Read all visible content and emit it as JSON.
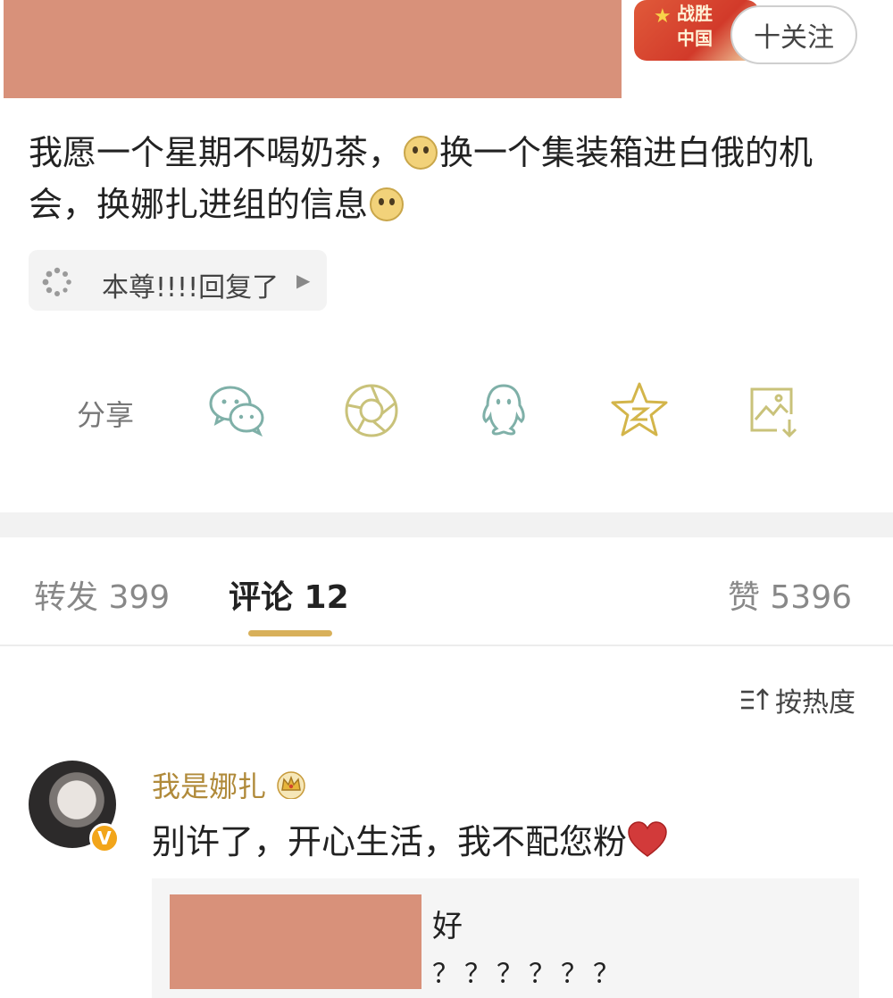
{
  "header": {
    "badge_text_line1": "战胜",
    "badge_text_line2": "中国",
    "follow_label": "十关注"
  },
  "post": {
    "text_part1": "我愿一个星期不喝奶茶，",
    "text_part2": "换一个集装箱进白俄的机会，换娜扎进组的信息",
    "reply_label": "本尊!!!!回复了"
  },
  "share": {
    "label": "分享",
    "icons": [
      "wechat-icon",
      "moments-icon",
      "qq-icon",
      "qzone-icon",
      "save-image-icon"
    ],
    "accent": "#c9b76a"
  },
  "tabs": {
    "repost": "转发 399",
    "comment": "评论 12",
    "like": "赞 5396",
    "underline_color": "#d8b05a"
  },
  "sort": {
    "label": "按热度"
  },
  "comment": {
    "username": "我是娜扎",
    "verified": "V",
    "text": "别许了，开心生活，我不配您粉",
    "reply_line1": "好",
    "reply_line2": "？？？？？？"
  }
}
